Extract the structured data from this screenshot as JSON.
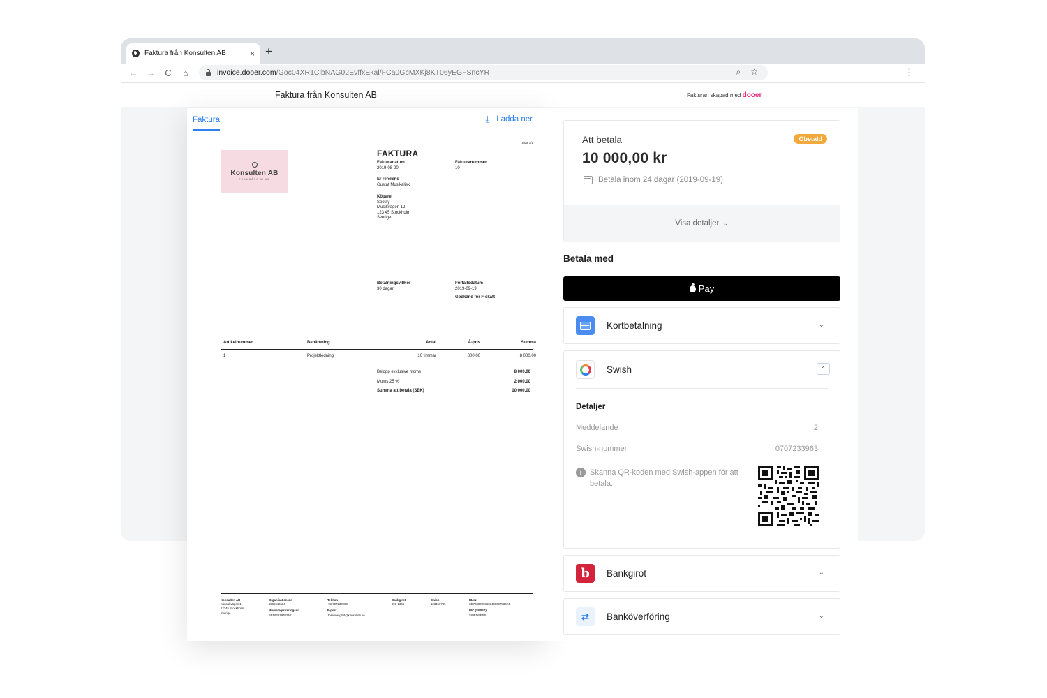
{
  "browser": {
    "tab_title": "Faktura från Konsulten AB",
    "tab_close": "×",
    "new_tab": "+",
    "url_host": "invoice.dooer.com",
    "url_path": "/Goc04XR1ClbNAG02EvffxEkal/FCa0GcMXKj8KT06yEGFSncYR",
    "nav": {
      "back": "←",
      "forward": "→",
      "reload": "C",
      "home": "⌂"
    },
    "icons": {
      "zoom": "⌕",
      "star": "☆",
      "menu": "⋮"
    }
  },
  "header": {
    "title": "Faktura från Konsulten AB",
    "created_by": "Fakturan skapad med",
    "brand": "dooer"
  },
  "invoice": {
    "tab": "Faktura",
    "download": "Ladda ner",
    "page": "Sida 1/1",
    "logo_name": "Konsulten AB",
    "logo_sub": "FRAMGÅNG AI AS",
    "heading": "FAKTURA",
    "fakturadatum_label": "Fakturadatum",
    "fakturadatum": "2019-08-20",
    "fakturanummer_label": "Fakturanummer",
    "fakturanummer": "10",
    "er_referens_label": "Er referens",
    "er_referens": "Gustaf Musikalisk",
    "kopare_label": "Köpare",
    "kopare_lines": [
      "Spotify",
      "Musikvägen 12",
      "123 45 Stockholm",
      "Sverige"
    ],
    "villkor_label": "Betalningsvillkor",
    "villkor": "30 dagar",
    "forfallodatum_label": "Förfallodatum",
    "forfallodatum": "2019-09-19",
    "fskatt": "Godkänd för F-skatt",
    "columns": [
      "Artikelnummer",
      "Benämning",
      "Antal",
      "À-pris",
      "Summa"
    ],
    "rows": [
      [
        "1",
        "Projektledning",
        "10 timmar",
        "800,00",
        "8 000,00"
      ]
    ],
    "totals": [
      {
        "label": "Belopp exklusive moms",
        "value": "8 000,00"
      },
      {
        "label": "Moms 25 %",
        "value": "2 000,00"
      },
      {
        "label": "Summa att betala (SEK)",
        "value": "10 000,00"
      }
    ],
    "footer": {
      "company": [
        "Konsulten AB",
        "Konsultvägen 1",
        "12345 Stockholm",
        "Sverige"
      ],
      "orgnr_label": "Organisationsnr.",
      "orgnr": "5569615114",
      "momsnr_label": "Momsregistreringsnr.",
      "momsnr": "SE562679702401",
      "telefon_label": "Telefon",
      "telefon": "+46707233963",
      "epost_label": "E-post",
      "epost": "Josefine.glad@konsulten.se",
      "bankgiro_label": "Bankgirot",
      "bankgiro": "991-2346",
      "swish_label": "Swish",
      "swish": "123456789",
      "iban_label": "IBAN",
      "iban": "SE7280000810340009783024",
      "bic_label": "BIC (SWIFT)",
      "bic": "SWEDSESS"
    }
  },
  "payment": {
    "att_betala": "Att betala",
    "status": "Obetald",
    "amount": "10 000,00 kr",
    "due": "Betala inom 24 dagar (2019-09-19)",
    "show_details": "Visa detaljer",
    "chevron": "⌄",
    "betala_med": "Betala med",
    "apple_pay": "Pay",
    "methods": {
      "card": "Kortbetalning",
      "swish": "Swish",
      "bankgirot": "Bankgirot",
      "bank": "Banköverföring"
    },
    "swish_details": {
      "title": "Detaljer",
      "meddelande_label": "Meddelande",
      "meddelande": "2",
      "nummer_label": "Swish-nummer",
      "nummer": "0707233963",
      "info": "Skanna QR-koden med Swish-appen för att betala."
    }
  }
}
